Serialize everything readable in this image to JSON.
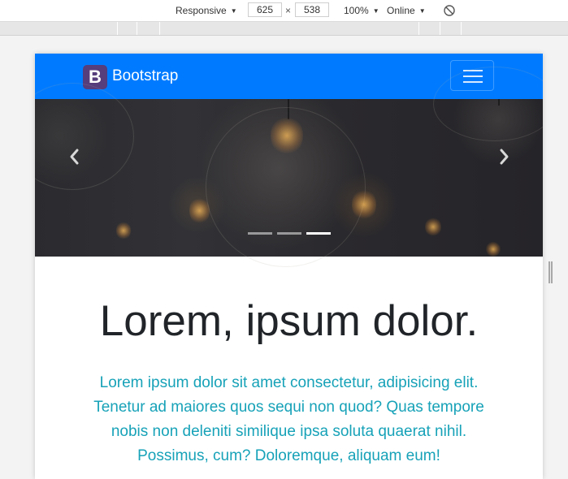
{
  "devtools": {
    "device": "Responsive",
    "width": "625",
    "times": "×",
    "height": "538",
    "zoom": "100%",
    "network": "Online",
    "rotate_icon": "rotate-icon"
  },
  "navbar": {
    "logo_letter": "B",
    "brand": "Bootstrap",
    "toggler_icon": "hamburger-icon",
    "background": "#007bff"
  },
  "carousel": {
    "prev_icon": "chevron-left-icon",
    "next_icon": "chevron-right-icon",
    "slide_count": 3,
    "active_index": 2
  },
  "hero": {
    "title": "Lorem, ipsum dolor.",
    "lead_lines": [
      "Lorem ipsum dolor sit amet consectetur, adipisicing elit.",
      "Tenetur ad maiores quos sequi non quod? Quas tempore",
      "nobis non deleniti similique ipsa soluta quaerat nihil.",
      "Possimus, cum? Doloremque, aliquam eum!"
    ],
    "lead_color": "#17a2b8"
  }
}
